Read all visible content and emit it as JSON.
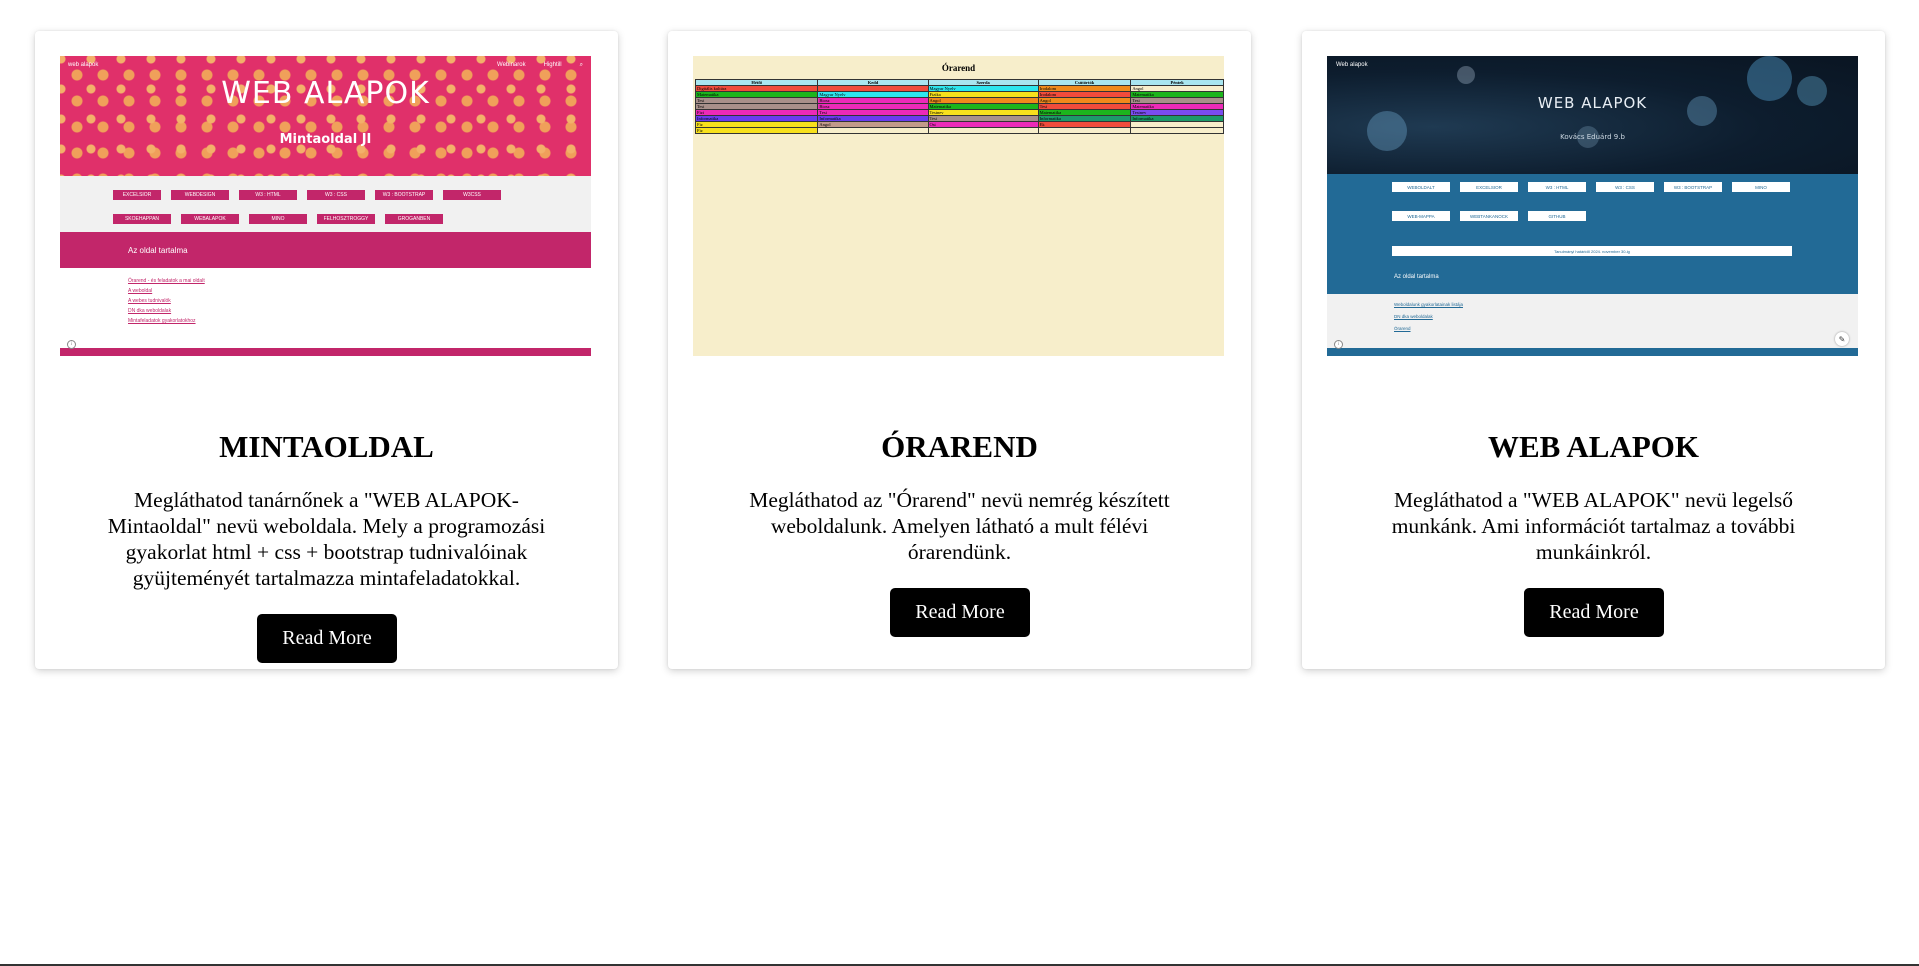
{
  "cards": [
    {
      "title": "MINTAOLDAL",
      "description": "Megláthatod tanárnőnek a \"WEB ALAPOK-Mintaoldal\" nevü weboldala. Mely a programozási gyakorlat html + css + bootstrap tudnivalóinak gyüjteményét tartalmazza mintafeladatokkal.",
      "button": "Read More",
      "preview": {
        "site_nav": "web alapok",
        "nav_right": [
          "Webinarok",
          "Hightill"
        ],
        "hero_title": "WEB ALAPOK",
        "hero_subtitle": "Mintaoldal JI",
        "menu_row1": [
          "EXCELSIOR",
          "WEBDESIGN",
          "W3 : HTML",
          "W3 : CSS",
          "W3 : BOOTSTRAP",
          "W3CSS"
        ],
        "menu_row2": [
          "SKOEHAPPAN",
          "WEBALAPOK",
          "MINO",
          "FELHOSZTROGGY",
          "GROGANBEN"
        ],
        "section_title": "Az oldal tartalma",
        "links": [
          "Órarend - és feladatok a mai oldalt",
          "A weboldal",
          "A webes tudnivalók",
          "DN dka weboldalak",
          "Mintafeladatok gyakorlatokhoz"
        ]
      }
    },
    {
      "title": "ÓRAREND",
      "description": "Megláthatod az \"Órarend\" nevü nemrég készített weboldalunk. Amelyen látható a mult félévi órarendünk.",
      "button": "Read More",
      "preview": {
        "table_title": "Órarend",
        "days": [
          "Hétfő",
          "Kedd",
          "Szerda",
          "Csütörtök",
          "Péntek"
        ],
        "rows": [
          [
            [
              "Digitális kultúra",
              "#f04c3c"
            ],
            [
              "",
              "#f04c3c"
            ],
            [
              "Magyar Nyelv",
              "#2ee6ee"
            ],
            [
              "Irodalom",
              "#f08a1c"
            ],
            [
              "Angol",
              "#f7eecb"
            ]
          ],
          [
            [
              "Matematika",
              "#1cb51c"
            ],
            [
              "Magyar Nyelv",
              "#2ee6ee"
            ],
            [
              "Fizika",
              "#f7e01c"
            ],
            [
              "Irodalom",
              "#f04c3c"
            ],
            [
              "Matematika",
              "#1cb51c"
            ]
          ],
          [
            [
              "Tesi",
              "#a8908a"
            ],
            [
              "Biosz",
              "#ec2ab8"
            ],
            [
              "Angol",
              "#f08a1c"
            ],
            [
              "Angol",
              "#f08a1c"
            ],
            [
              "Tesi",
              "#a8908a"
            ]
          ],
          [
            [
              "Tesi",
              "#a8908a"
            ],
            [
              "Biosz",
              "#ec2ab8"
            ],
            [
              "Matematika",
              "#1cb51c"
            ],
            [
              "Tesi",
              "#f04c3c"
            ],
            [
              "Matematika",
              "#ec2ab8"
            ]
          ],
          [
            [
              "Fizi",
              "#ec2ab8"
            ],
            [
              "Tesi",
              "#ec2ab8"
            ],
            [
              "Testnev",
              "#f7e01c"
            ],
            [
              "Matematika",
              "#1cb51c"
            ],
            [
              "Testnev",
              "#7a4cf0"
            ]
          ],
          [
            [
              "Informatika",
              "#6a3cf0"
            ],
            [
              "Informatika",
              "#6a3cf0"
            ],
            [
              "Tesi",
              "#a8908a"
            ],
            [
              "Informatika",
              "#1c9a6a"
            ],
            [
              "Informatika",
              "#1c9a6a"
            ]
          ],
          [
            [
              "Fiz",
              "#f7e01c"
            ],
            [
              "Angol",
              "#c29a8a"
            ],
            [
              "Ost",
              "#ec2ab8"
            ],
            [
              "Ek",
              "#f04c3c"
            ],
            [
              "",
              "#f7eecb"
            ]
          ],
          [
            [
              "Fiz",
              "#f7e01c"
            ],
            [
              "",
              "#f7eecb"
            ],
            [
              "",
              "#f7eecb"
            ],
            [
              "",
              "#f7eecb"
            ],
            [
              "",
              "#f7eecb"
            ]
          ]
        ]
      }
    },
    {
      "title": "WEB ALAPOK",
      "description": "Megláthatod a \"WEB ALAPOK\" nevü legelső munkánk. Ami információt tartalmaz a további munkáinkról.",
      "button": "Read More",
      "preview": {
        "site_nav": "Web alapok",
        "hero_title": "WEB ALAPOK",
        "hero_subtitle": "Kovács Eduárd 9.b",
        "menu_row1": [
          "WEBOLDALT",
          "EXCELSIOR",
          "W3 : HTML",
          "W3 : CSS",
          "W3 : BOOTSTRAP",
          "MINO"
        ],
        "menu_row2": [
          "WEB-MAPPA",
          "WEBTANKANOCK",
          "GITHUB"
        ],
        "wide_bar": "Tanulmányi határidő 2024. november 30-ig",
        "section_title": "Az oldal tartalma",
        "links": [
          "Weboldalunk gyakorlatainak listája",
          "DN dka weboldalak",
          "Órarend"
        ]
      }
    }
  ]
}
